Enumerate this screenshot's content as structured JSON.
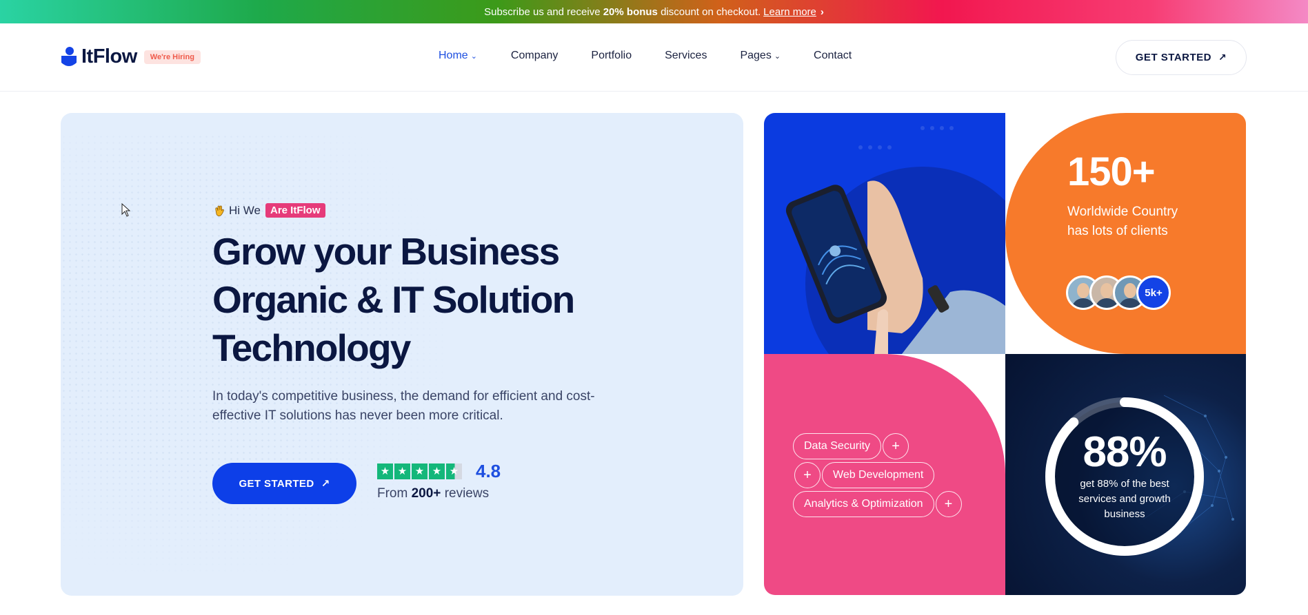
{
  "topbar": {
    "text_before": "Subscribe us and receive",
    "bonus": "20% bonus",
    "text_after": "discount on checkout.",
    "learn_more": "Learn more",
    "chevron_icon": "chevron-right-icon",
    "gradient_colors": [
      "#2ad3a3",
      "#3c9a19",
      "#f2174f",
      "#f489c5"
    ]
  },
  "header": {
    "logo_text": "ItFlow",
    "hiring_badge": "We're Hiring",
    "nav": [
      {
        "label": "Home",
        "active": true,
        "has_caret": true
      },
      {
        "label": "Company"
      },
      {
        "label": "Portfolio"
      },
      {
        "label": "Services"
      },
      {
        "label": "Pages",
        "has_caret": true
      },
      {
        "label": "Contact"
      }
    ],
    "cta": "GET STARTED",
    "cta_icon": "arrow-up-right-icon",
    "accent_color": "#1e4fe0"
  },
  "hero": {
    "greeting": "Hi We",
    "greeting_badge": "Are ItFlow",
    "greeting_icon": "waving-hand-icon",
    "title_line1": "Grow your Business",
    "title_line2": "Organic & IT Solution",
    "title_line3": "Technology",
    "description": "In today's competitive business, the demand for efficient and cost-effective IT solutions has never been more critical.",
    "cta": "GET STARTED",
    "rating": {
      "score": "4.8",
      "stars": 4.5,
      "reviews_prefix": "From",
      "reviews_count": "200+",
      "reviews_suffix": "reviews",
      "star_color": "#14b77a"
    },
    "background_color": "#e3eefc"
  },
  "stats_tile": {
    "value": "150+",
    "line1": "Worldwide Country",
    "line2": "has lots of clients",
    "avatar_more": "5k+",
    "color": "#f77a2b"
  },
  "services_tile": {
    "tags": [
      "Data Security",
      "Web Development",
      "Analytics & Optimization"
    ],
    "color": "#ef4a85"
  },
  "progress_tile": {
    "value": "88%",
    "progress_fraction": 0.88,
    "line1": "get 88% of the best",
    "line2": "services and growth",
    "line3": "business"
  },
  "image_tile": {
    "color": "#0b3be0"
  }
}
